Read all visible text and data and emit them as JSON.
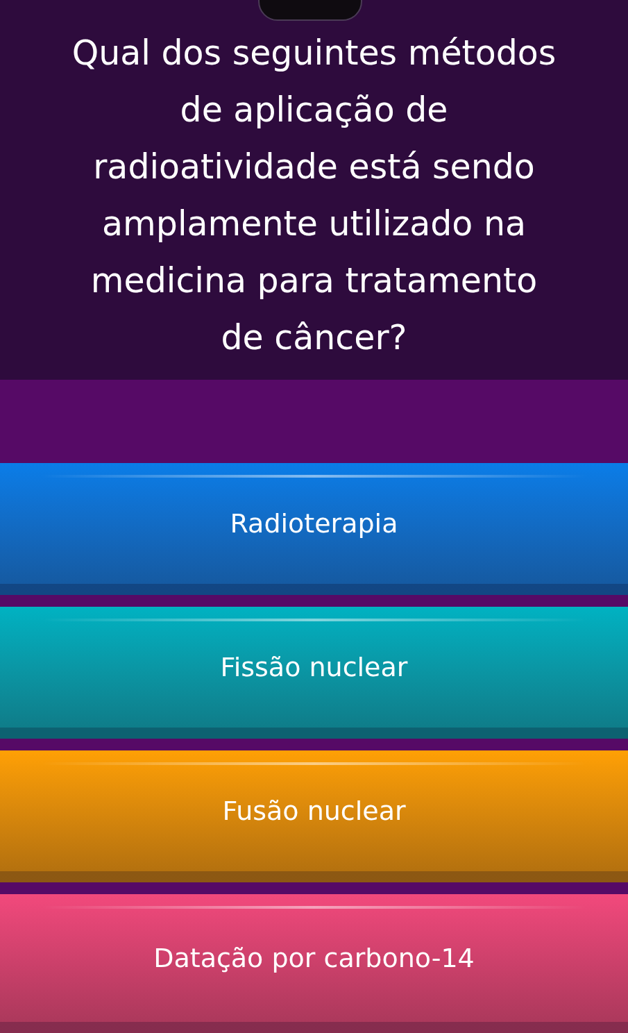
{
  "question": "Qual dos seguintes métodos de aplicação de radioatividade está sendo amplamente utilizado na medicina para tratamento de câncer?",
  "options": [
    {
      "label": "Radioterapia",
      "color": "#0a7de8"
    },
    {
      "label": "Fissão nuclear",
      "color": "#00b2c2"
    },
    {
      "label": "Fusão nuclear",
      "color": "#ffa005"
    },
    {
      "label": "Datação por carbono-14",
      "color": "#f2497c"
    }
  ]
}
